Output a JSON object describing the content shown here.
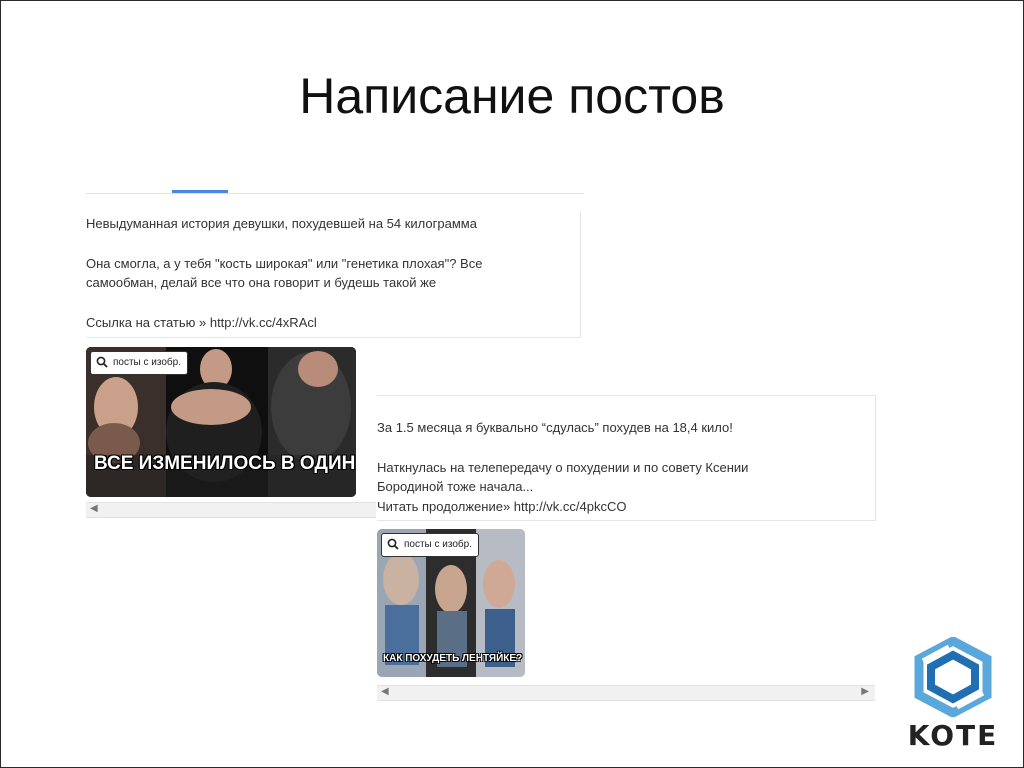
{
  "slide": {
    "title": "Написание постов"
  },
  "post1": {
    "line1": "Невыдуманная история девушки, похудевшей на 54 килограмма",
    "line2": "Она смогла, а у тебя \"кость широкая\" или \"генетика плохая\"? Все",
    "line3": "самообман, делай все что она говорит и будешь такой же",
    "line4": "Ссылка на статью » http://vk.cc/4xRAcl",
    "badge": "посты с изобр.",
    "overlay_text": "ВСЕ ИЗМЕНИЛОСЬ В ОДИН МИГ..."
  },
  "post2": {
    "line1": "За 1.5 месяца я буквально “сдулась” похудев на 18,4 кило!",
    "line2": "Наткнулась на телепередачу о похудении и по совету Ксении",
    "line3": "Бородиной тоже начала...",
    "line4": "Читать продолжение» http://vk.cc/4pkcCO",
    "badge": "посты с изобр.",
    "overlay_text": "КАК ПОХУДЕТЬ ЛЕНТЯЙКЕ?"
  },
  "logo": {
    "text": "KOTE",
    "color_primary": "#1f6fb2",
    "color_light": "#5aa7dc"
  },
  "icons": {
    "search": "search-icon",
    "scroll_left": "chevron-left-icon",
    "scroll_right": "chevron-right-icon"
  },
  "colors": {
    "tab_accent": "#4a86e8",
    "text": "#333333"
  }
}
